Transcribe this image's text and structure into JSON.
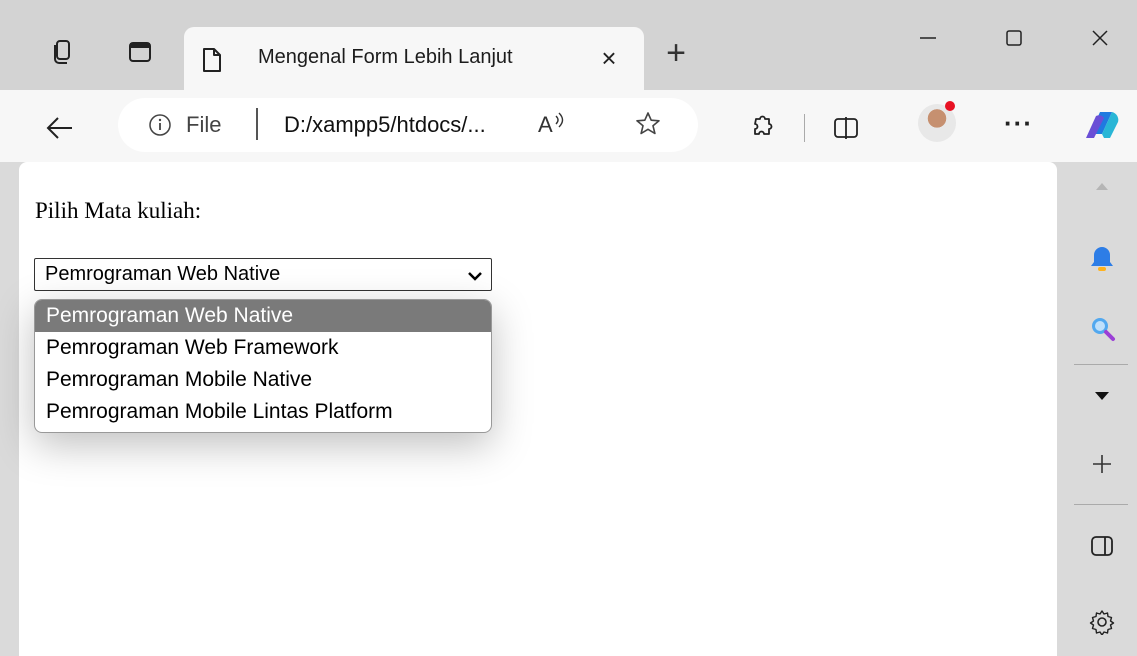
{
  "browser": {
    "tab_title": "Mengenal Form Lebih Lanjut",
    "tab_close": "×",
    "new_tab": "+",
    "address": {
      "scheme_label": "File",
      "url": "D:/xampp5/htdocs/..."
    },
    "read_aloud": "A",
    "more": "···",
    "notification_color": "#e81123"
  },
  "page": {
    "label": "Pilih Mata kuliah:",
    "select": {
      "value": "Pemrograman Web Native",
      "options": [
        "Pemrograman Web Native",
        "Pemrograman Web Framework",
        "Pemrograman Mobile Native",
        "Pemrograman Mobile Lintas Platform"
      ],
      "selected_index": 0
    }
  },
  "icons": {
    "titlebar": [
      "workspaces-icon",
      "vertical-tabs-icon",
      "page-icon"
    ],
    "window": [
      "minimize-icon",
      "maximize-icon",
      "close-window-icon"
    ],
    "toolbar": [
      "back-arrow-icon",
      "info-icon",
      "read-aloud-icon",
      "favorite-star-icon",
      "extensions-icon",
      "split-screen-icon",
      "profile-avatar",
      "more-icon",
      "copilot-icon"
    ],
    "sidebar": [
      "scroll-up-icon",
      "bell-icon",
      "search-icon",
      "collapse-icon",
      "add-icon",
      "sidebar-panel-icon",
      "settings-icon"
    ]
  }
}
